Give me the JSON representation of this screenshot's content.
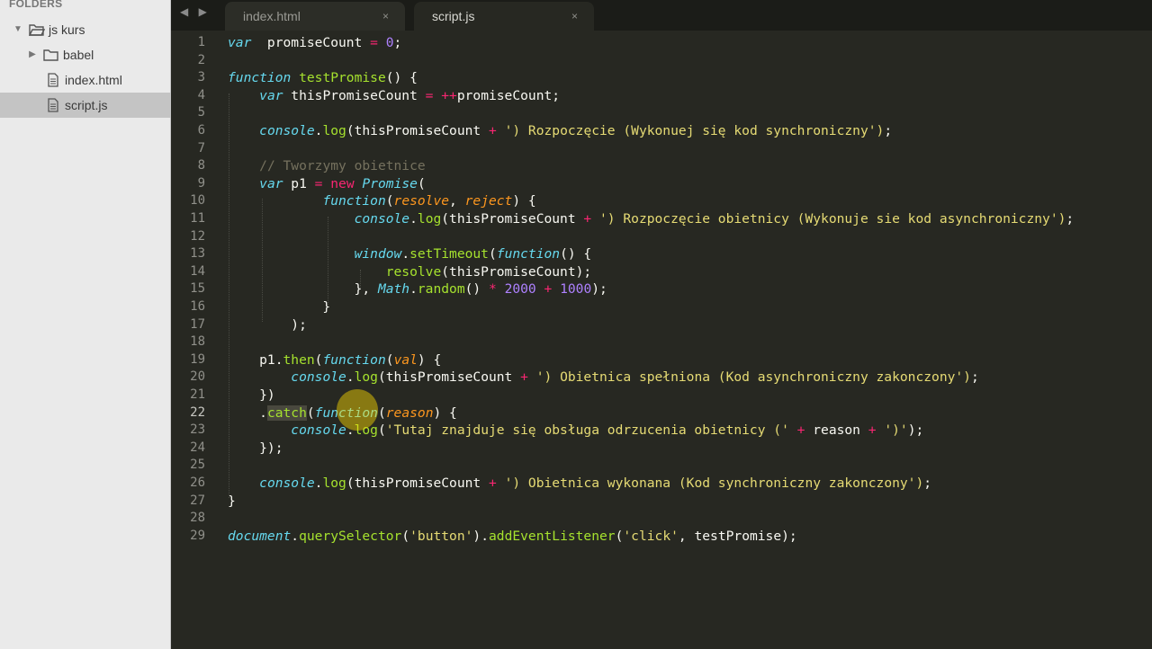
{
  "sidebar": {
    "header": "FOLDERS",
    "items": [
      {
        "label": "js kurs",
        "type": "folder-open"
      },
      {
        "label": "babel",
        "type": "folder"
      },
      {
        "label": "index.html",
        "type": "file"
      },
      {
        "label": "script.js",
        "type": "file",
        "selected": true
      }
    ]
  },
  "tabs": [
    {
      "label": "index.html",
      "close": "×",
      "active": false
    },
    {
      "label": "script.js",
      "close": "×",
      "active": true
    }
  ],
  "nav_arrows": "◀ ▶",
  "editor": {
    "current_line": 22,
    "lines": [
      {
        "n": "1"
      },
      {
        "n": "2"
      },
      {
        "n": "3"
      },
      {
        "n": "4"
      },
      {
        "n": "5"
      },
      {
        "n": "6"
      },
      {
        "n": "7"
      },
      {
        "n": "8"
      },
      {
        "n": "9"
      },
      {
        "n": "10"
      },
      {
        "n": "11"
      },
      {
        "n": "12"
      },
      {
        "n": "13"
      },
      {
        "n": "14"
      },
      {
        "n": "15"
      },
      {
        "n": "16"
      },
      {
        "n": "17"
      },
      {
        "n": "18"
      },
      {
        "n": "19"
      },
      {
        "n": "20"
      },
      {
        "n": "21"
      },
      {
        "n": "22"
      },
      {
        "n": "23"
      },
      {
        "n": "24"
      },
      {
        "n": "25"
      },
      {
        "n": "26"
      },
      {
        "n": "27"
      },
      {
        "n": "28"
      },
      {
        "n": "29"
      }
    ],
    "code": [
      [
        [
          "kw-s",
          "var"
        ],
        [
          "",
          "  promiseCount "
        ],
        [
          "op",
          "="
        ],
        [
          "",
          ""
        ],
        [
          "num",
          " 0"
        ],
        [
          "",
          ";"
        ]
      ],
      [],
      [
        [
          "kw-s",
          "function"
        ],
        [
          "",
          " "
        ],
        [
          "fn",
          "testPromise"
        ],
        [
          "",
          "() {"
        ]
      ],
      [
        [
          "",
          "    "
        ],
        [
          "kw-s",
          "var"
        ],
        [
          "",
          " thisPromiseCount "
        ],
        [
          "op",
          "="
        ],
        [
          "",
          " "
        ],
        [
          "op",
          "++"
        ],
        [
          "",
          "promiseCount;"
        ]
      ],
      [],
      [
        [
          "",
          "    "
        ],
        [
          "kw-s",
          "console"
        ],
        [
          "",
          "."
        ],
        [
          "fn",
          "log"
        ],
        [
          "",
          "(thisPromiseCount "
        ],
        [
          "op",
          "+"
        ],
        [
          "",
          " "
        ],
        [
          "str",
          "') Rozpoczęcie (Wykonuej się kod synchroniczny')"
        ],
        [
          "",
          ";"
        ]
      ],
      [],
      [
        [
          "",
          "    "
        ],
        [
          "cmt",
          "// Tworzymy obietnice"
        ]
      ],
      [
        [
          "",
          "    "
        ],
        [
          "kw-s",
          "var"
        ],
        [
          "",
          " p1 "
        ],
        [
          "op",
          "="
        ],
        [
          "",
          " "
        ],
        [
          "kw-r",
          "new"
        ],
        [
          "",
          " "
        ],
        [
          "kw-s",
          "Promise"
        ],
        [
          "",
          "("
        ]
      ],
      [
        [
          "",
          "            "
        ],
        [
          "kw-s",
          "function"
        ],
        [
          "",
          "("
        ],
        [
          "param",
          "resolve"
        ],
        [
          "",
          ", "
        ],
        [
          "param",
          "reject"
        ],
        [
          "",
          ") {"
        ]
      ],
      [
        [
          "",
          "                "
        ],
        [
          "kw-s",
          "console"
        ],
        [
          "",
          "."
        ],
        [
          "fn",
          "log"
        ],
        [
          "",
          "(thisPromiseCount "
        ],
        [
          "op",
          "+"
        ],
        [
          "",
          " "
        ],
        [
          "str",
          "') Rozpoczęcie obietnicy (Wykonuje sie kod asynchroniczny')"
        ],
        [
          "",
          ";"
        ]
      ],
      [],
      [
        [
          "",
          "                "
        ],
        [
          "kw-s",
          "window"
        ],
        [
          "",
          "."
        ],
        [
          "fn",
          "setTimeout"
        ],
        [
          "",
          "("
        ],
        [
          "kw-s",
          "function"
        ],
        [
          "",
          "() {"
        ]
      ],
      [
        [
          "",
          "                    "
        ],
        [
          "fn",
          "resolve"
        ],
        [
          "",
          "(thisPromiseCount);"
        ]
      ],
      [
        [
          "",
          "                }, "
        ],
        [
          "kw-s",
          "Math"
        ],
        [
          "",
          "."
        ],
        [
          "fn",
          "random"
        ],
        [
          "",
          "() "
        ],
        [
          "op",
          "*"
        ],
        [
          "",
          " "
        ],
        [
          "num",
          "2000"
        ],
        [
          "",
          " "
        ],
        [
          "op",
          "+"
        ],
        [
          "",
          " "
        ],
        [
          "num",
          "1000"
        ],
        [
          "",
          ");"
        ]
      ],
      [
        [
          "",
          "            }"
        ]
      ],
      [
        [
          "",
          "        );"
        ]
      ],
      [],
      [
        [
          "",
          "    p1."
        ],
        [
          "fn",
          "then"
        ],
        [
          "",
          "("
        ],
        [
          "kw-s",
          "function"
        ],
        [
          "",
          "("
        ],
        [
          "param",
          "val"
        ],
        [
          "",
          ") {"
        ]
      ],
      [
        [
          "",
          "        "
        ],
        [
          "kw-s",
          "console"
        ],
        [
          "",
          "."
        ],
        [
          "fn",
          "log"
        ],
        [
          "",
          "(thisPromiseCount "
        ],
        [
          "op",
          "+"
        ],
        [
          "",
          " "
        ],
        [
          "str",
          "') Obietnica spełniona (Kod asynchroniczny zakonczony')"
        ],
        [
          "",
          ";"
        ]
      ],
      [
        [
          "",
          "    })"
        ]
      ],
      [
        [
          "",
          "    ."
        ],
        [
          "fn sel",
          "catch"
        ],
        [
          "",
          "("
        ],
        [
          "kw-s",
          "function"
        ],
        [
          "",
          "("
        ],
        [
          "param",
          "reason"
        ],
        [
          "",
          ") {"
        ]
      ],
      [
        [
          "",
          "        "
        ],
        [
          "kw-s",
          "console"
        ],
        [
          "",
          "."
        ],
        [
          "fn",
          "log"
        ],
        [
          "",
          "("
        ],
        [
          "str",
          "'Tutaj znajduje się obsługa odrzucenia obietnicy ('"
        ],
        [
          "",
          " "
        ],
        [
          "op",
          "+"
        ],
        [
          "",
          " reason "
        ],
        [
          "op",
          "+"
        ],
        [
          "",
          " "
        ],
        [
          "str",
          "')'"
        ],
        [
          "",
          ");"
        ]
      ],
      [
        [
          "",
          "    });"
        ]
      ],
      [],
      [
        [
          "",
          "    "
        ],
        [
          "kw-s",
          "console"
        ],
        [
          "",
          "."
        ],
        [
          "fn",
          "log"
        ],
        [
          "",
          "(thisPromiseCount "
        ],
        [
          "op",
          "+"
        ],
        [
          "",
          " "
        ],
        [
          "str",
          "') Obietnica wykonana (Kod synchroniczny zakonczony')"
        ],
        [
          "",
          ";"
        ]
      ],
      [
        [
          "",
          "}"
        ]
      ],
      [],
      [
        [
          "kw-s",
          "document"
        ],
        [
          "",
          "."
        ],
        [
          "fn",
          "querySelector"
        ],
        [
          "",
          "("
        ],
        [
          "str",
          "'button'"
        ],
        [
          "",
          ")."
        ],
        [
          "fn",
          "addEventListener"
        ],
        [
          "",
          "("
        ],
        [
          "str",
          "'click'"
        ],
        [
          "",
          ", testPromise);"
        ]
      ]
    ]
  },
  "colors": {
    "background": "#272822",
    "keyword_storage": "#66d9ef",
    "keyword": "#f92672",
    "function": "#a6e22e",
    "parameter": "#fd971f",
    "string": "#e6db74",
    "number": "#ae81ff",
    "comment": "#75715e"
  }
}
